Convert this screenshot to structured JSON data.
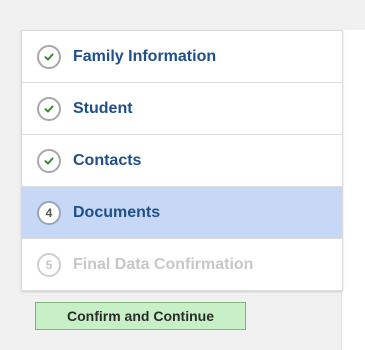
{
  "steps": [
    {
      "label": "Family Information",
      "state": "complete",
      "icon": "check-icon"
    },
    {
      "label": "Student",
      "state": "complete",
      "icon": "check-icon"
    },
    {
      "label": "Contacts",
      "state": "complete",
      "icon": "check-icon"
    },
    {
      "label": "Documents",
      "state": "active",
      "number": "4"
    },
    {
      "label": "Final Data Confirmation",
      "state": "disabled",
      "number": "5"
    }
  ],
  "confirm_button": {
    "label": "Confirm and Continue"
  },
  "colors": {
    "active_step_bg": "#c6d8f6",
    "step_label": "#1f4f8a",
    "check_green": "#2e8b2e",
    "disabled_text": "#c7c7c7",
    "confirm_bg": "#c7f0c7",
    "confirm_border": "#7fb27f"
  }
}
